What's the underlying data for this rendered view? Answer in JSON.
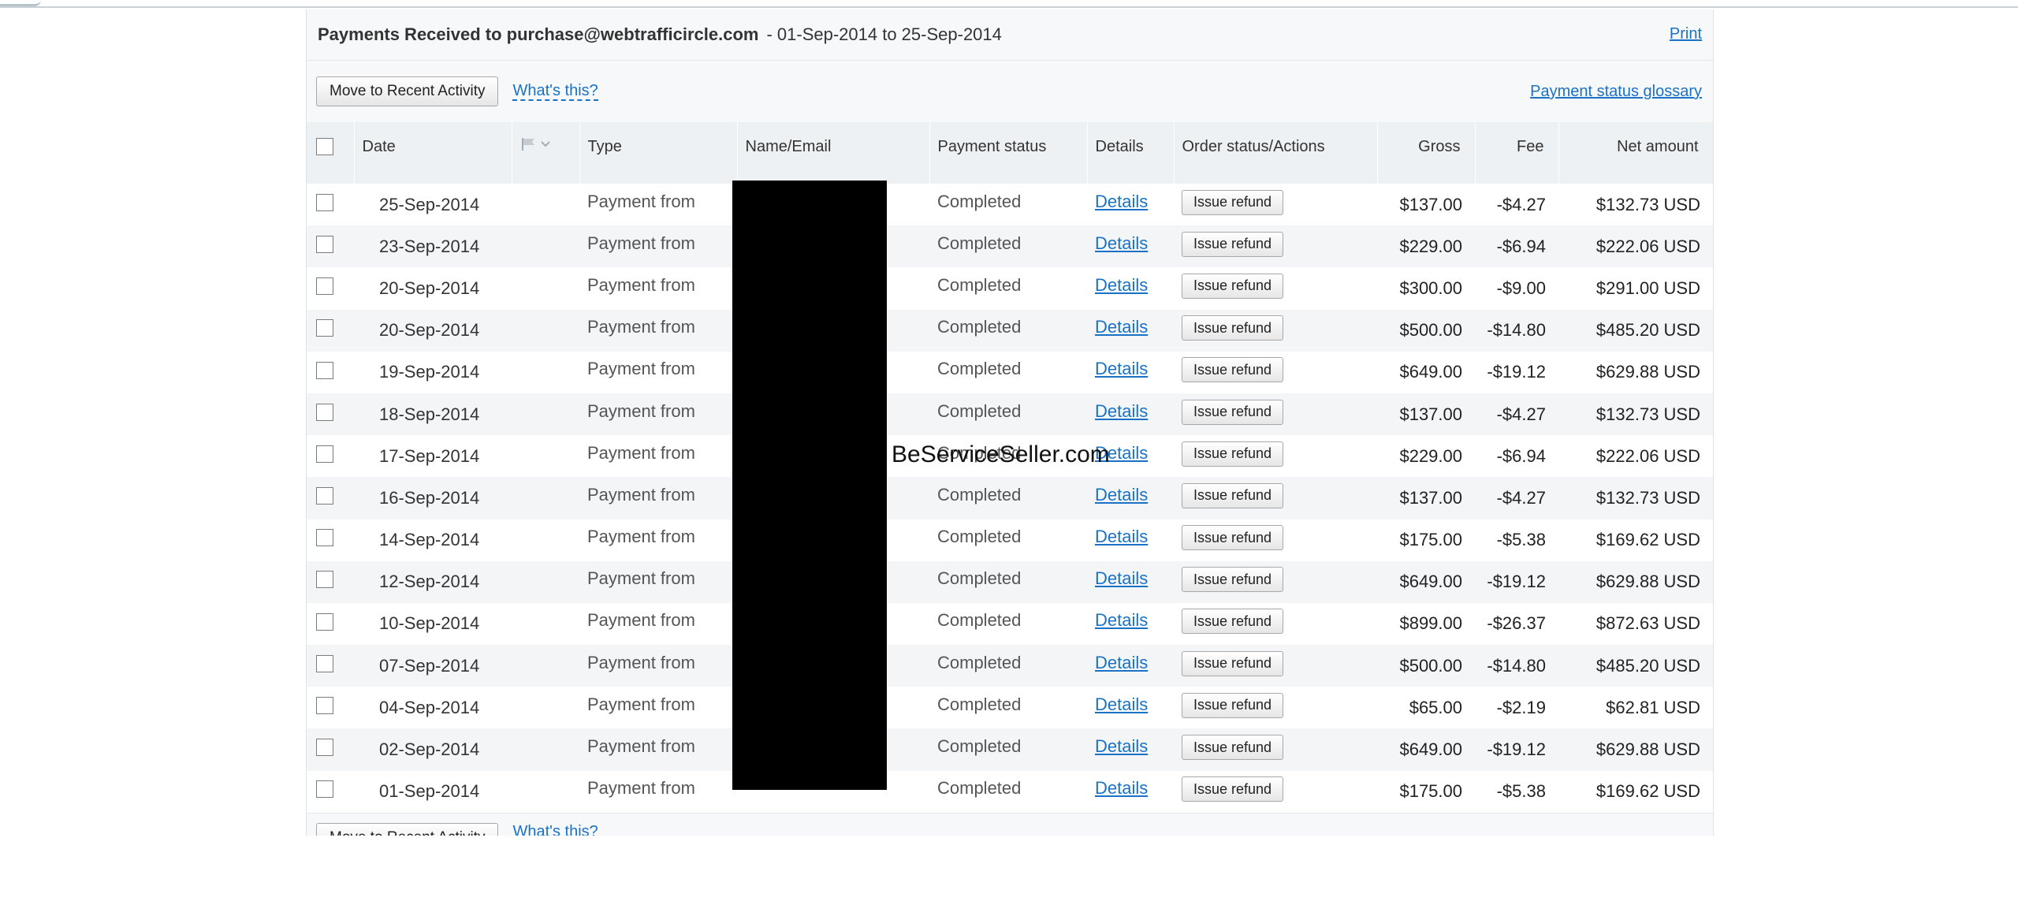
{
  "header": {
    "title_strong": "Payments Received to purchase@webtrafficircle.com",
    "title_range": " - 01-Sep-2014 to 25-Sep-2014",
    "print_label": "Print"
  },
  "actions": {
    "move_label": "Move to Recent Activity",
    "whats_this": "What's this?",
    "glossary": "Payment status glossary"
  },
  "columns": {
    "date": "Date",
    "type": "Type",
    "name": "Name/Email",
    "status": "Payment status",
    "details": "Details",
    "order": "Order status/Actions",
    "gross": "Gross",
    "fee": "Fee",
    "net": "Net amount"
  },
  "icons": {
    "flag": "flag-icon",
    "caret": "caret-down-icon"
  },
  "rows": [
    {
      "date": "25-Sep-2014",
      "type": "Payment from",
      "status": "Completed",
      "details": "Details",
      "action": "Issue refund",
      "gross": "$137.00",
      "fee": "-$4.27",
      "net": "$132.73 USD"
    },
    {
      "date": "23-Sep-2014",
      "type": "Payment from",
      "status": "Completed",
      "details": "Details",
      "action": "Issue refund",
      "gross": "$229.00",
      "fee": "-$6.94",
      "net": "$222.06 USD"
    },
    {
      "date": "20-Sep-2014",
      "type": "Payment from",
      "status": "Completed",
      "details": "Details",
      "action": "Issue refund",
      "gross": "$300.00",
      "fee": "-$9.00",
      "net": "$291.00 USD"
    },
    {
      "date": "20-Sep-2014",
      "type": "Payment from",
      "status": "Completed",
      "details": "Details",
      "action": "Issue refund",
      "gross": "$500.00",
      "fee": "-$14.80",
      "net": "$485.20 USD"
    },
    {
      "date": "19-Sep-2014",
      "type": "Payment from",
      "status": "Completed",
      "details": "Details",
      "action": "Issue refund",
      "gross": "$649.00",
      "fee": "-$19.12",
      "net": "$629.88 USD"
    },
    {
      "date": "18-Sep-2014",
      "type": "Payment from",
      "status": "Completed",
      "details": "Details",
      "action": "Issue refund",
      "gross": "$137.00",
      "fee": "-$4.27",
      "net": "$132.73 USD"
    },
    {
      "date": "17-Sep-2014",
      "type": "Payment from",
      "status": "Completed",
      "details": "Details",
      "action": "Issue refund",
      "gross": "$229.00",
      "fee": "-$6.94",
      "net": "$222.06 USD"
    },
    {
      "date": "16-Sep-2014",
      "type": "Payment from",
      "status": "Completed",
      "details": "Details",
      "action": "Issue refund",
      "gross": "$137.00",
      "fee": "-$4.27",
      "net": "$132.73 USD"
    },
    {
      "date": "14-Sep-2014",
      "type": "Payment from",
      "status": "Completed",
      "details": "Details",
      "action": "Issue refund",
      "gross": "$175.00",
      "fee": "-$5.38",
      "net": "$169.62 USD"
    },
    {
      "date": "12-Sep-2014",
      "type": "Payment from",
      "status": "Completed",
      "details": "Details",
      "action": "Issue refund",
      "gross": "$649.00",
      "fee": "-$19.12",
      "net": "$629.88 USD"
    },
    {
      "date": "10-Sep-2014",
      "type": "Payment from",
      "status": "Completed",
      "details": "Details",
      "action": "Issue refund",
      "gross": "$899.00",
      "fee": "-$26.37",
      "net": "$872.63 USD"
    },
    {
      "date": "07-Sep-2014",
      "type": "Payment from",
      "status": "Completed",
      "details": "Details",
      "action": "Issue refund",
      "gross": "$500.00",
      "fee": "-$14.80",
      "net": "$485.20 USD"
    },
    {
      "date": "04-Sep-2014",
      "type": "Payment from",
      "status": "Completed",
      "details": "Details",
      "action": "Issue refund",
      "gross": "$65.00",
      "fee": "-$2.19",
      "net": "$62.81 USD"
    },
    {
      "date": "02-Sep-2014",
      "type": "Payment from",
      "status": "Completed",
      "details": "Details",
      "action": "Issue refund",
      "gross": "$649.00",
      "fee": "-$19.12",
      "net": "$629.88 USD"
    },
    {
      "date": "01-Sep-2014",
      "type": "Payment from",
      "status": "Completed",
      "details": "Details",
      "action": "Issue refund",
      "gross": "$175.00",
      "fee": "-$5.38",
      "net": "$169.62 USD"
    }
  ],
  "footer": {
    "move_label": "Move to Recent Activity",
    "whats_this": "What's this?"
  },
  "watermark": "BeServiceSeller.com"
}
